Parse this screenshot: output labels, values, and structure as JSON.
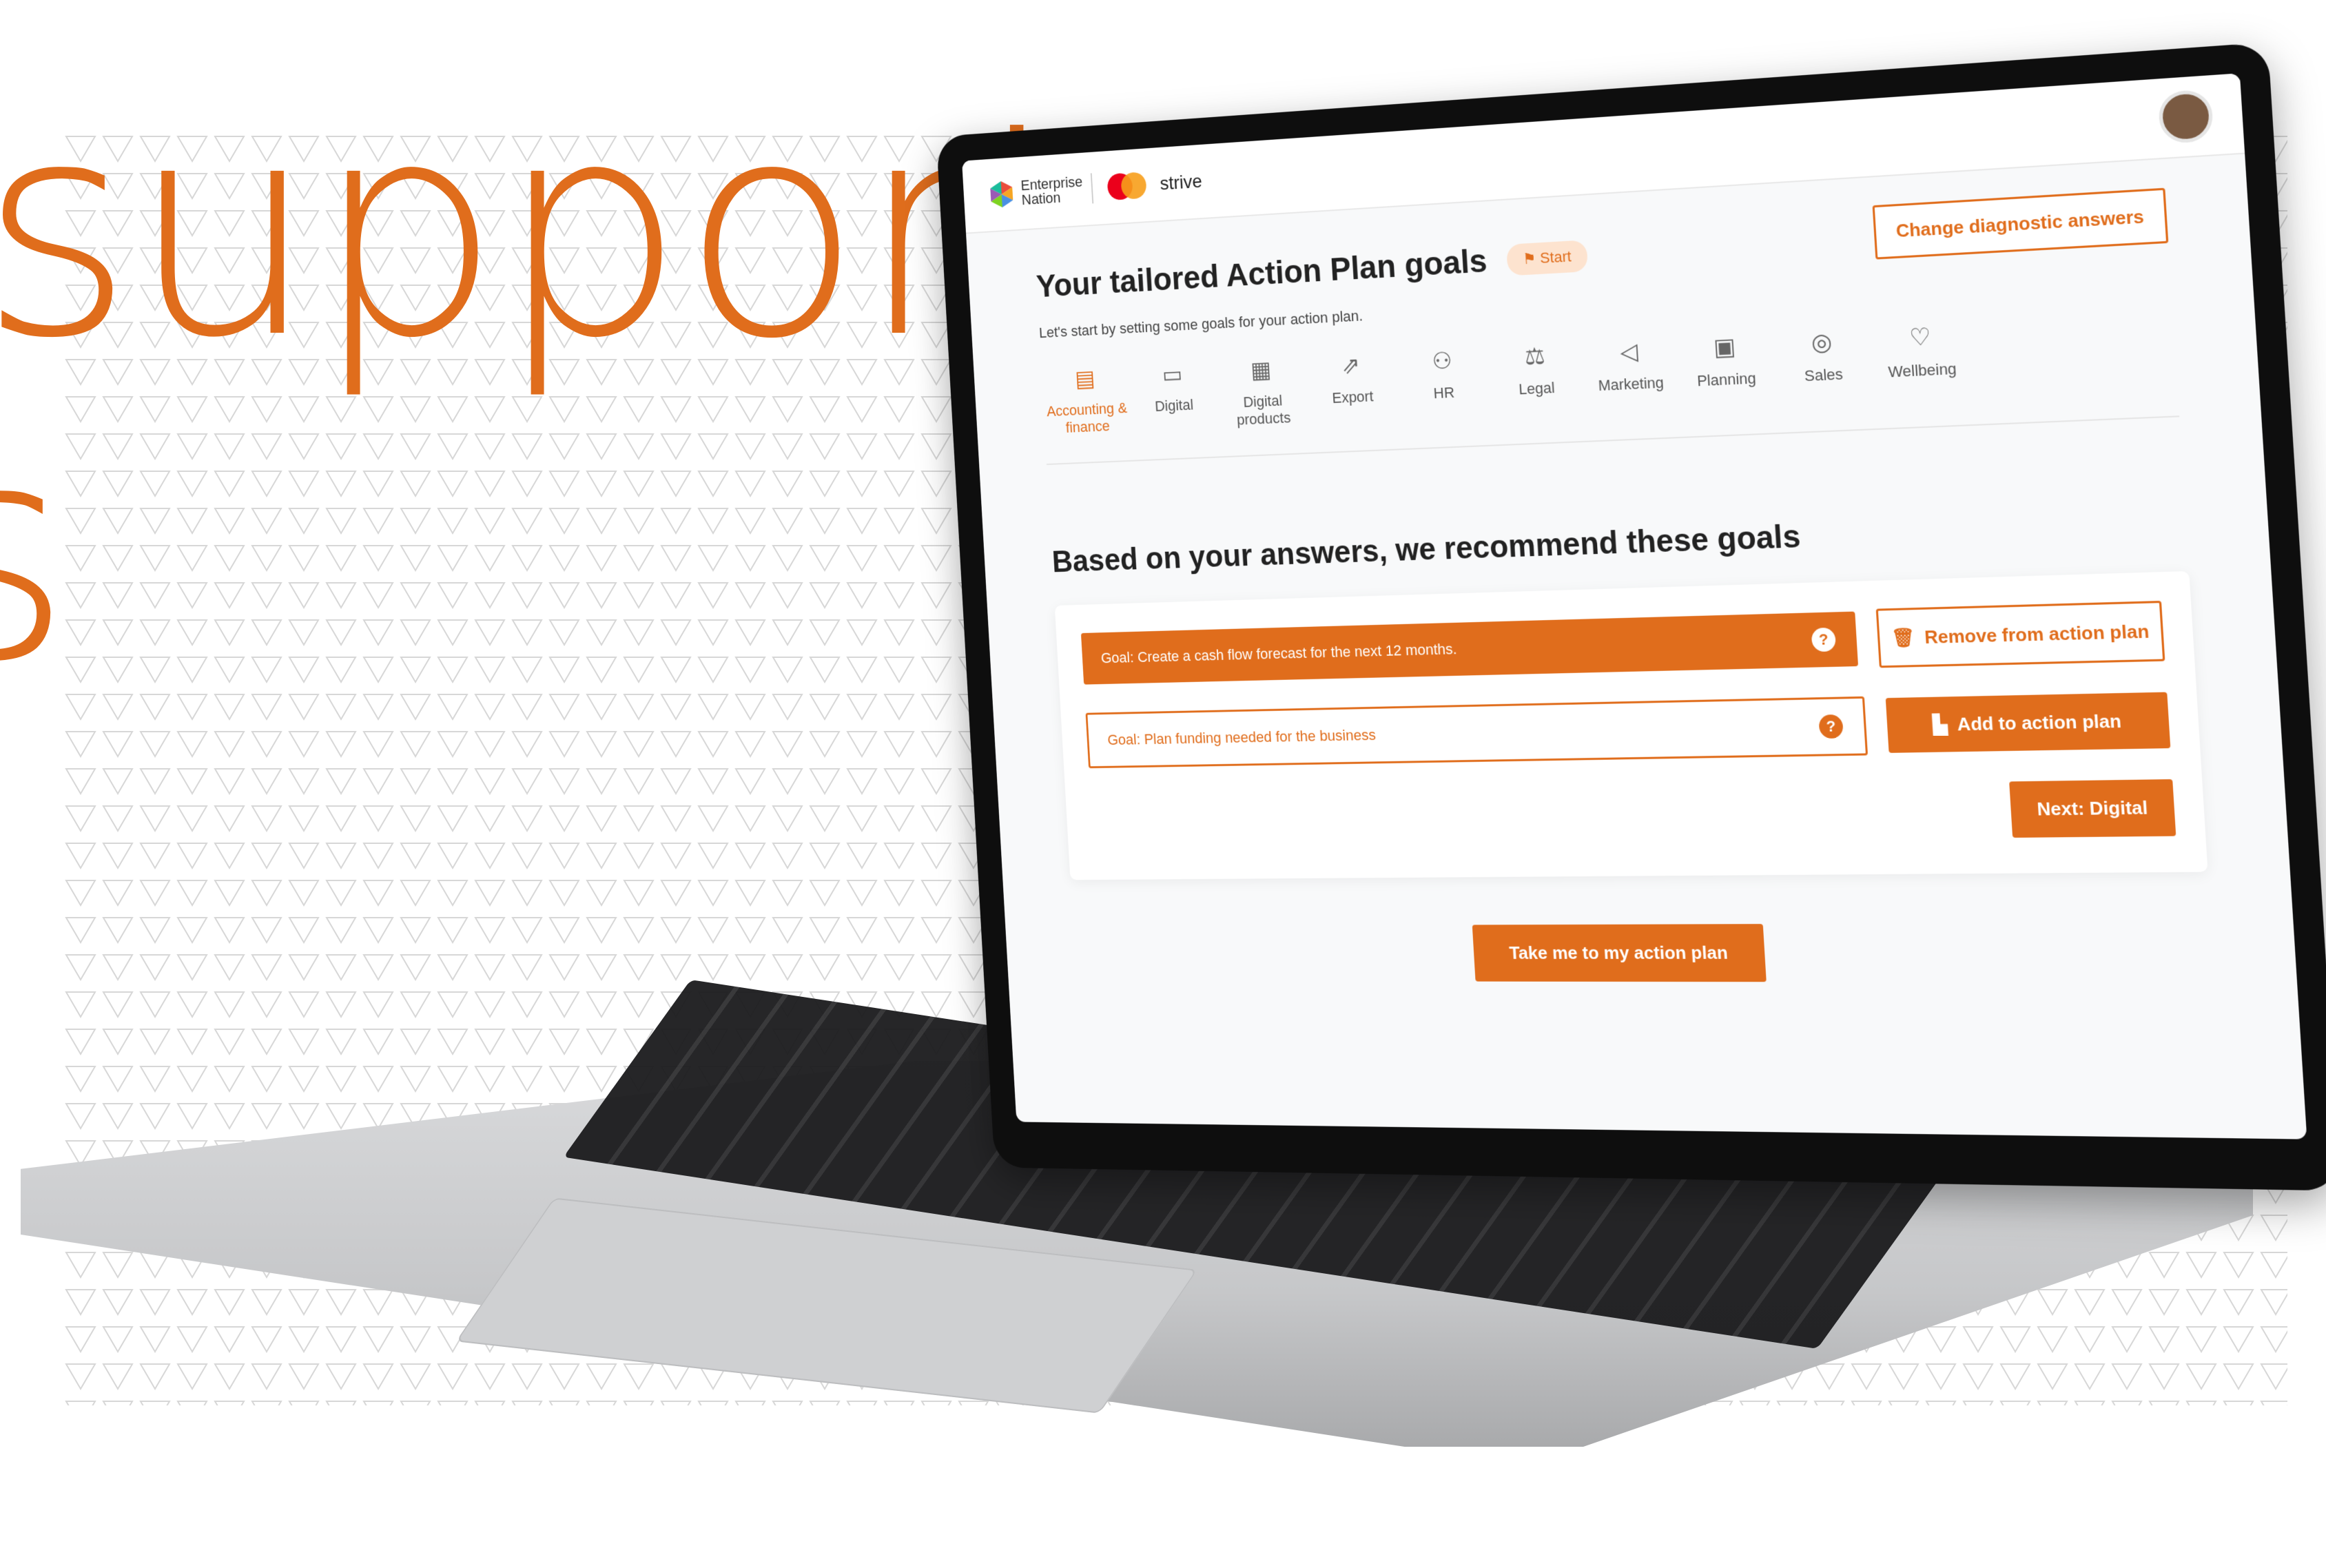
{
  "hero": {
    "word": "support",
    "fragment": "s"
  },
  "app": {
    "logo_text": "Enterprise Nation",
    "brand": "strive",
    "title": "Your tailored Action Plan goals",
    "start_badge": "Start",
    "change_button": "Change diagnostic answers",
    "subtitle": "Let's start by setting some goals for your action plan.",
    "categories": [
      {
        "label": "Accounting & finance",
        "icon": "ledger-icon",
        "active": true
      },
      {
        "label": "Digital",
        "icon": "monitor-icon",
        "active": false
      },
      {
        "label": "Digital products",
        "icon": "calculator-icon",
        "active": false
      },
      {
        "label": "Export",
        "icon": "export-icon",
        "active": false
      },
      {
        "label": "HR",
        "icon": "people-icon",
        "active": false
      },
      {
        "label": "Legal",
        "icon": "gavel-icon",
        "active": false
      },
      {
        "label": "Marketing",
        "icon": "megaphone-icon",
        "active": false
      },
      {
        "label": "Planning",
        "icon": "chart-icon",
        "active": false
      },
      {
        "label": "Sales",
        "icon": "sales-icon",
        "active": false
      },
      {
        "label": "Wellbeing",
        "icon": "wellbeing-icon",
        "active": false
      }
    ],
    "recommend_title": "Based on your answers, we recommend these goals",
    "goals": [
      {
        "text": "Goal: Create a cash flow forecast for the next 12 months.",
        "button": "Remove from action plan",
        "selected": true
      },
      {
        "text": "Goal: Plan funding needed for the business",
        "button": "Add to action plan",
        "selected": false
      }
    ],
    "next_button": "Next: Digital",
    "take_button": "Take me to my action plan",
    "accent_color": "#e06d1c"
  }
}
